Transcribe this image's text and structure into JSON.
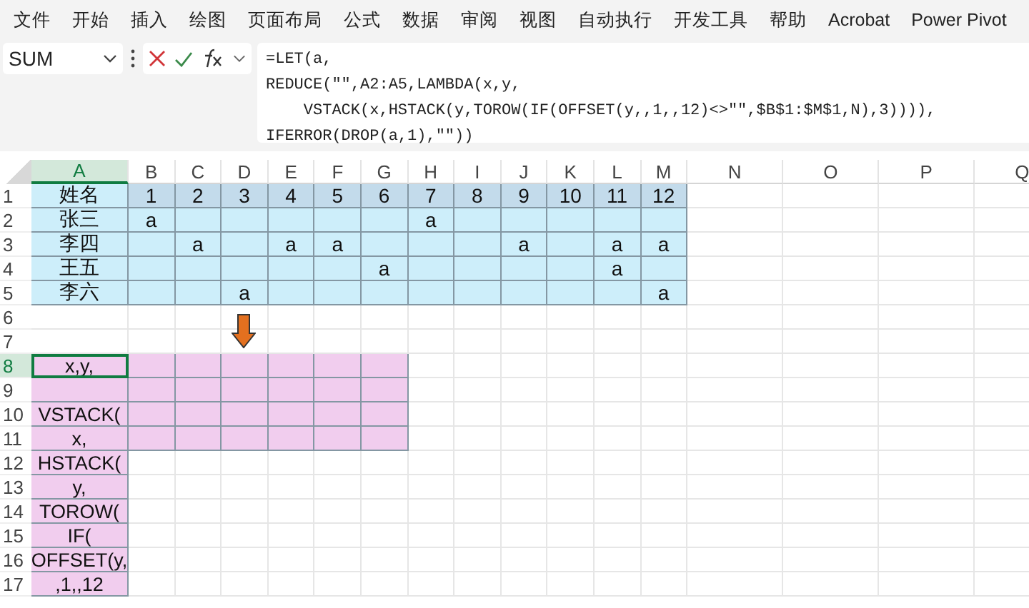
{
  "ribbon_tabs": [
    "文件",
    "开始",
    "插入",
    "绘图",
    "页面布局",
    "公式",
    "数据",
    "审阅",
    "视图",
    "自动执行",
    "开发工具",
    "帮助",
    "Acrobat",
    "Power Pivot"
  ],
  "formula_bar": {
    "name_box": "SUM",
    "formula_lines": [
      "=LET(a,",
      "REDUCE(\"\",A2:A5,LAMBDA(x,y,",
      "    VSTACK(x,HSTACK(y,TOROW(IF(OFFSET(y,,1,,12)<>\"\",$B$1:$M$1,N),3)))),",
      "IFERROR(DROP(a,1),\"\"))"
    ]
  },
  "sheet": {
    "columns": [
      "A",
      "B",
      "C",
      "D",
      "E",
      "F",
      "G",
      "H",
      "I",
      "J",
      "K",
      "L",
      "M",
      "N",
      "O",
      "P",
      "Q"
    ],
    "rows": [
      {
        "number": "1",
        "cells": {
          "A": {
            "text": "姓名",
            "color": "#cdeefa"
          },
          "B": {
            "text": "1",
            "color": "#c3dbeb"
          },
          "C": {
            "text": "2",
            "color": "#c3dbeb"
          },
          "D": {
            "text": "3",
            "color": "#c3dbeb"
          },
          "E": {
            "text": "4",
            "color": "#c3dbeb"
          },
          "F": {
            "text": "5",
            "color": "#c3dbeb"
          },
          "G": {
            "text": "6",
            "color": "#c3dbeb"
          },
          "H": {
            "text": "7",
            "color": "#c3dbeb"
          },
          "I": {
            "text": "8",
            "color": "#c3dbeb"
          },
          "J": {
            "text": "9",
            "color": "#c3dbeb"
          },
          "K": {
            "text": "10",
            "color": "#c3dbeb"
          },
          "L": {
            "text": "11",
            "color": "#c3dbeb"
          },
          "M": {
            "text": "12",
            "color": "#c3dbeb"
          }
        }
      },
      {
        "number": "2",
        "cells": {
          "A": {
            "text": "张三",
            "color": "#cdeefa"
          },
          "B": {
            "text": "a",
            "color": "#cdeefa"
          },
          "C": {
            "color": "#cdeefa"
          },
          "D": {
            "color": "#cdeefa"
          },
          "E": {
            "color": "#cdeefa"
          },
          "F": {
            "color": "#cdeefa"
          },
          "G": {
            "color": "#cdeefa"
          },
          "H": {
            "text": "a",
            "color": "#cdeefa"
          },
          "I": {
            "color": "#cdeefa"
          },
          "J": {
            "color": "#cdeefa"
          },
          "K": {
            "color": "#cdeefa"
          },
          "L": {
            "color": "#cdeefa"
          },
          "M": {
            "color": "#cdeefa"
          }
        }
      },
      {
        "number": "3",
        "cells": {
          "A": {
            "text": "李四",
            "color": "#cdeefa"
          },
          "B": {
            "color": "#cdeefa"
          },
          "C": {
            "text": "a",
            "color": "#cdeefa"
          },
          "D": {
            "color": "#cdeefa"
          },
          "E": {
            "text": "a",
            "color": "#cdeefa"
          },
          "F": {
            "text": "a",
            "color": "#cdeefa"
          },
          "G": {
            "color": "#cdeefa"
          },
          "H": {
            "color": "#cdeefa"
          },
          "I": {
            "color": "#cdeefa"
          },
          "J": {
            "text": "a",
            "color": "#cdeefa"
          },
          "K": {
            "color": "#cdeefa"
          },
          "L": {
            "text": "a",
            "color": "#cdeefa"
          },
          "M": {
            "text": "a",
            "color": "#cdeefa"
          }
        }
      },
      {
        "number": "4",
        "cells": {
          "A": {
            "text": "王五",
            "color": "#cdeefa"
          },
          "B": {
            "color": "#cdeefa"
          },
          "C": {
            "color": "#cdeefa"
          },
          "D": {
            "color": "#cdeefa"
          },
          "E": {
            "color": "#cdeefa"
          },
          "F": {
            "color": "#cdeefa"
          },
          "G": {
            "text": "a",
            "color": "#cdeefa"
          },
          "H": {
            "color": "#cdeefa"
          },
          "I": {
            "color": "#cdeefa"
          },
          "J": {
            "color": "#cdeefa"
          },
          "K": {
            "color": "#cdeefa"
          },
          "L": {
            "text": "a",
            "color": "#cdeefa"
          },
          "M": {
            "color": "#cdeefa"
          }
        }
      },
      {
        "number": "5",
        "cells": {
          "A": {
            "text": "李六",
            "color": "#cdeefa"
          },
          "B": {
            "color": "#cdeefa"
          },
          "C": {
            "color": "#cdeefa"
          },
          "D": {
            "text": "a",
            "color": "#cdeefa"
          },
          "E": {
            "color": "#cdeefa"
          },
          "F": {
            "color": "#cdeefa"
          },
          "G": {
            "color": "#cdeefa"
          },
          "H": {
            "color": "#cdeefa"
          },
          "I": {
            "color": "#cdeefa"
          },
          "J": {
            "color": "#cdeefa"
          },
          "K": {
            "color": "#cdeefa"
          },
          "L": {
            "color": "#cdeefa"
          },
          "M": {
            "text": "a",
            "color": "#cdeefa"
          }
        }
      },
      {
        "number": "6",
        "cells": {}
      },
      {
        "number": "7",
        "cells": {}
      },
      {
        "number": "8",
        "cells": {
          "A": {
            "text": "x,y,",
            "color": "#f1cdee",
            "selected": true
          },
          "B": {
            "color": "#f1cdee"
          },
          "C": {
            "color": "#f1cdee"
          },
          "D": {
            "color": "#f1cdee"
          },
          "E": {
            "color": "#f1cdee"
          },
          "F": {
            "color": "#f1cdee"
          },
          "G": {
            "color": "#f1cdee"
          }
        }
      },
      {
        "number": "9",
        "cells": {
          "A": {
            "color": "#f1cdee"
          },
          "B": {
            "color": "#f1cdee"
          },
          "C": {
            "color": "#f1cdee"
          },
          "D": {
            "color": "#f1cdee"
          },
          "E": {
            "color": "#f1cdee"
          },
          "F": {
            "color": "#f1cdee"
          },
          "G": {
            "color": "#f1cdee"
          }
        }
      },
      {
        "number": "10",
        "cells": {
          "A": {
            "text": "VSTACK(",
            "color": "#f1cdee"
          },
          "B": {
            "color": "#f1cdee"
          },
          "C": {
            "color": "#f1cdee"
          },
          "D": {
            "color": "#f1cdee"
          },
          "E": {
            "color": "#f1cdee"
          },
          "F": {
            "color": "#f1cdee"
          },
          "G": {
            "color": "#f1cdee"
          }
        }
      },
      {
        "number": "11",
        "cells": {
          "A": {
            "text": "x,",
            "color": "#f1cdee"
          },
          "B": {
            "color": "#f1cdee"
          },
          "C": {
            "color": "#f1cdee"
          },
          "D": {
            "color": "#f1cdee"
          },
          "E": {
            "color": "#f1cdee"
          },
          "F": {
            "color": "#f1cdee"
          },
          "G": {
            "color": "#f1cdee"
          }
        }
      },
      {
        "number": "12",
        "cells": {
          "A": {
            "text": "HSTACK(",
            "color": "#f1cdee"
          }
        }
      },
      {
        "number": "13",
        "cells": {
          "A": {
            "text": "y,",
            "color": "#f1cdee"
          }
        }
      },
      {
        "number": "14",
        "cells": {
          "A": {
            "text": "TOROW(",
            "color": "#f1cdee"
          }
        }
      },
      {
        "number": "15",
        "cells": {
          "A": {
            "text": "IF(",
            "color": "#f1cdee"
          }
        }
      },
      {
        "number": "16",
        "cells": {
          "A": {
            "text": "OFFSET(y,",
            "color": "#f1cdee"
          }
        }
      },
      {
        "number": "17",
        "cells": {
          "A": {
            "text": ",1,,12",
            "color": "#f1cdee"
          }
        }
      }
    ]
  }
}
